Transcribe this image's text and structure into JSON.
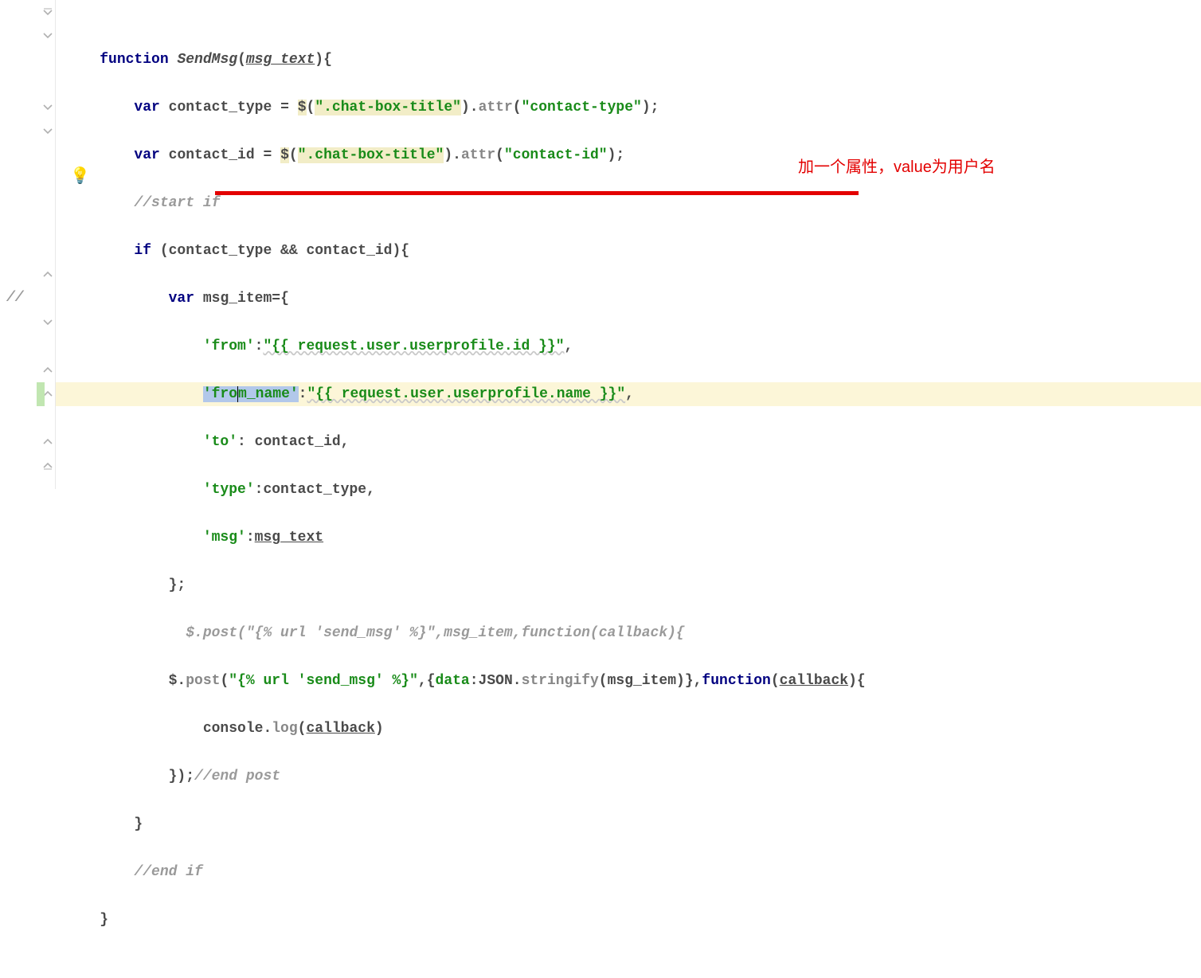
{
  "annotation_text": "加一个属性，value为用户名",
  "gutter_comment": "//",
  "code": {
    "l1": {
      "t1": "function ",
      "t2": "SendMsg",
      "t3": "(",
      "t4": "msg_text",
      "t5": "){"
    },
    "l2": {
      "t1": "var ",
      "t2": "contact_type ",
      "t3": "= ",
      "t4": "$",
      "t5": "(",
      "t6": "\".chat-box-title\"",
      "t7": ").",
      "t8": "attr",
      "t9": "(",
      "t10": "\"contact-type\"",
      "t11": ");"
    },
    "l3": {
      "t1": "var ",
      "t2": "contact_id ",
      "t3": "= ",
      "t4": "$",
      "t5": "(",
      "t6": "\".chat-box-title\"",
      "t7": ").",
      "t8": "attr",
      "t9": "(",
      "t10": "\"contact-id\"",
      "t11": ");"
    },
    "l4": {
      "t1": "//start if"
    },
    "l5": {
      "t1": "if ",
      "t2": "(contact_type && contact_id){"
    },
    "l6": {
      "t1": "var ",
      "t2": "msg_item",
      "t3": "={"
    },
    "l7": {
      "t1": "'from'",
      "t2": ":",
      "t3": "\"{{ request.user.userprofile.id }}\"",
      "t4": ","
    },
    "l8": {
      "t1": "'fro",
      "t2": "m",
      "t3": "_name'",
      "t4": ":",
      "t5": "\"{{ request.user.userprofile.name }}\"",
      "t6": ","
    },
    "l9": {
      "t1": "'to'",
      "t2": ": contact_id,"
    },
    "l10": {
      "t1": "'type'",
      "t2": ":contact_type,"
    },
    "l11": {
      "t1": "'msg'",
      "t2": ":",
      "t3": "msg_text"
    },
    "l12": {
      "t1": "};"
    },
    "l13": {
      "t1": "$.post(\"{% url 'send_msg' %}\",msg_item,function(callback){"
    },
    "l14": {
      "t1": "$.",
      "t2": "post",
      "t3": "(",
      "t4": "\"{% url 'send_msg' %}\"",
      "t5": ",{",
      "t6": "data",
      "t7": ":",
      "t8": "JSON",
      "t9": ".",
      "t10": "stringify",
      "t11": "(msg_item)},",
      "t12": "function",
      "t13": "(",
      "t14": "callback",
      "t15": "){"
    },
    "l15": {
      "t1": "console.",
      "t2": "log",
      "t3": "(",
      "t4": "callback",
      "t5": ")"
    },
    "l16": {
      "t1": "});",
      "t2": "//end post"
    },
    "l17": {
      "t1": "}"
    },
    "l18": {
      "t1": "//end if"
    },
    "l19": {
      "t1": "}"
    }
  }
}
